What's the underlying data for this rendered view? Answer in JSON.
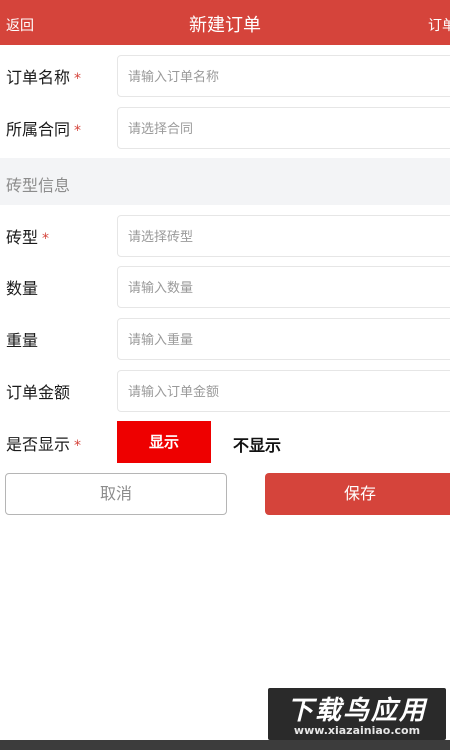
{
  "header": {
    "back_label": "返回",
    "title": "新建订单",
    "right_label": "订单"
  },
  "form": {
    "required_mark": "*",
    "order_name": {
      "label": "订单名称",
      "placeholder": "请输入订单名称"
    },
    "contract": {
      "label": "所属合同",
      "placeholder": "请选择合同"
    },
    "section_title": "砖型信息",
    "brick_type": {
      "label": "砖型",
      "placeholder": "请选择砖型"
    },
    "quantity": {
      "label": "数量",
      "placeholder": "请输入数量"
    },
    "weight": {
      "label": "重量",
      "placeholder": "请输入重量"
    },
    "amount": {
      "label": "订单金额",
      "placeholder": "请输入订单金额"
    },
    "display": {
      "label": "是否显示",
      "on_label": "显示",
      "off_label": "不显示",
      "selected": "显示"
    }
  },
  "actions": {
    "cancel_label": "取消",
    "save_label": "保存"
  },
  "watermark": {
    "logo_text": "下载鸟应用",
    "url_text": "www.xiazainiao.com"
  },
  "colors": {
    "accent": "#d5443b",
    "toggle_active": "#ee0000"
  }
}
